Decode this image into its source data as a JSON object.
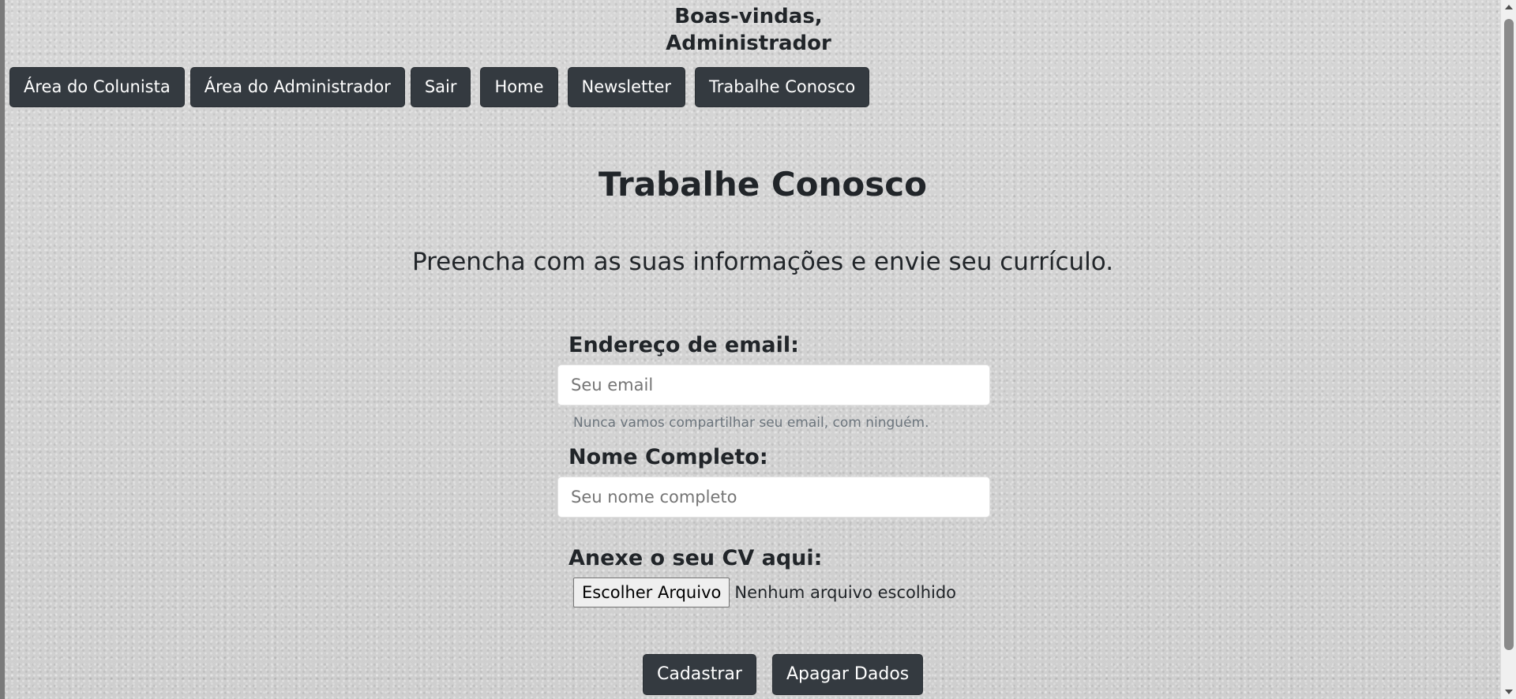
{
  "header": {
    "welcome_line1": "Boas-vindas,",
    "welcome_line2": "Administrador"
  },
  "nav": {
    "items": [
      "Área do Colunista",
      "Área do Administrador",
      "Sair",
      "Home",
      "Newsletter",
      "Trabalhe Conosco"
    ]
  },
  "main": {
    "title": "Trabalhe Conosco",
    "subtitle": "Preencha com as suas informações e envie seu currículo."
  },
  "form": {
    "email_label": "Endereço de email:",
    "email_placeholder": "Seu email",
    "email_help": "Nunca vamos compartilhar seu email, com ninguém.",
    "name_label": "Nome Completo:",
    "name_placeholder": "Seu nome completo",
    "cv_label": "Anexe o seu CV aqui:",
    "file_button": "Escolher Arquivo",
    "file_status": "Nenhum arquivo escolhido",
    "submit_label": "Cadastrar",
    "clear_label": "Apagar Dados"
  },
  "colors": {
    "button_bg": "#343a40",
    "text": "#212529",
    "muted": "#6c757d"
  }
}
